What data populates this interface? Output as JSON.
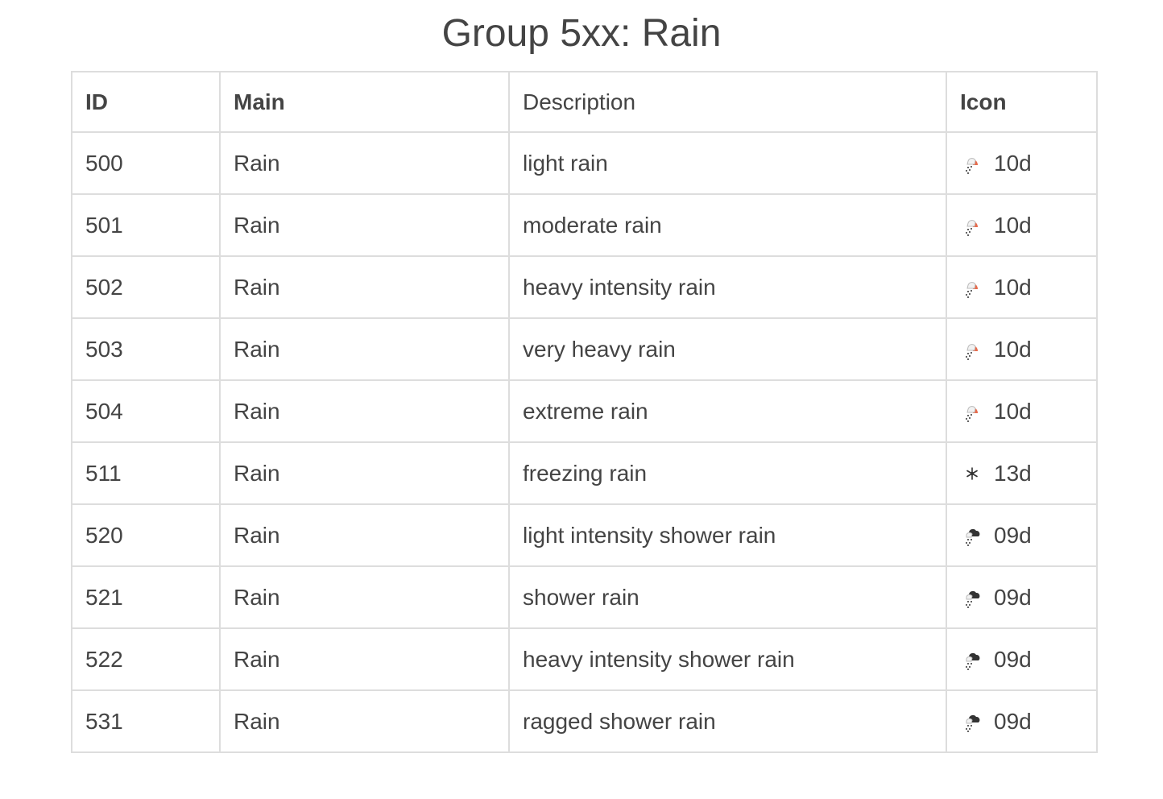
{
  "title": "Group 5xx: Rain",
  "headers": {
    "id": "ID",
    "main": "Main",
    "description": "Description",
    "icon": "Icon"
  },
  "rows": [
    {
      "id": "500",
      "main": "Rain",
      "description": "light rain",
      "icon": "10d",
      "icon_name": "sun-rain-icon"
    },
    {
      "id": "501",
      "main": "Rain",
      "description": "moderate rain",
      "icon": "10d",
      "icon_name": "sun-rain-icon"
    },
    {
      "id": "502",
      "main": "Rain",
      "description": "heavy intensity rain",
      "icon": "10d",
      "icon_name": "sun-rain-icon"
    },
    {
      "id": "503",
      "main": "Rain",
      "description": "very heavy rain",
      "icon": "10d",
      "icon_name": "sun-rain-icon"
    },
    {
      "id": "504",
      "main": "Rain",
      "description": "extreme rain",
      "icon": "10d",
      "icon_name": "sun-rain-icon"
    },
    {
      "id": "511",
      "main": "Rain",
      "description": "freezing rain",
      "icon": "13d",
      "icon_name": "snowflake-icon"
    },
    {
      "id": "520",
      "main": "Rain",
      "description": "light intensity shower rain",
      "icon": "09d",
      "icon_name": "cloud-rain-icon"
    },
    {
      "id": "521",
      "main": "Rain",
      "description": "shower rain",
      "icon": "09d",
      "icon_name": "cloud-rain-icon"
    },
    {
      "id": "522",
      "main": "Rain",
      "description": "heavy intensity shower rain",
      "icon": "09d",
      "icon_name": "cloud-rain-icon"
    },
    {
      "id": "531",
      "main": "Rain",
      "description": "ragged shower rain",
      "icon": "09d",
      "icon_name": "cloud-rain-icon"
    }
  ],
  "colors": {
    "text": "#444444",
    "border": "#dddddd",
    "sun": "#e8694a",
    "cloud": "#333333"
  }
}
